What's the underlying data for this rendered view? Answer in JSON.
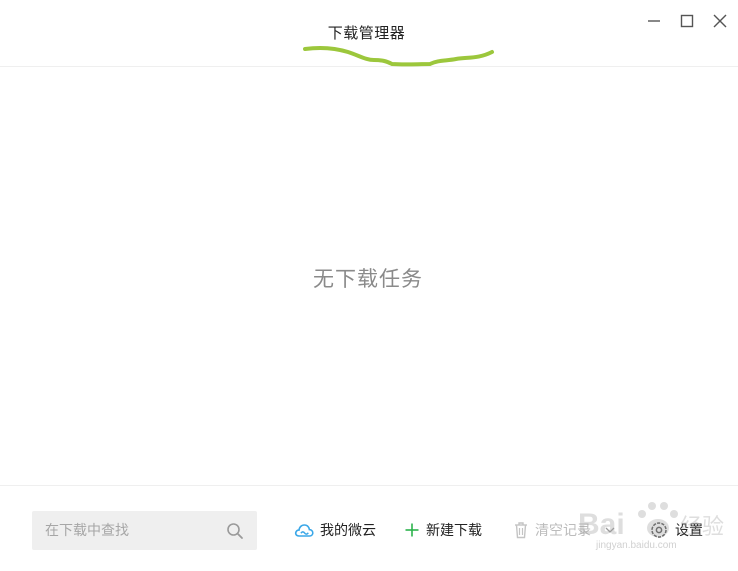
{
  "window": {
    "title": "下载管理器"
  },
  "main": {
    "empty_message": "无下载任务"
  },
  "toolbar": {
    "search_placeholder": "在下载中查找",
    "search_value": "",
    "my_cloud_label": "我的微云",
    "new_download_label": "新建下载",
    "clear_records_label": "清空记录",
    "settings_label": "设置"
  },
  "watermark": {
    "text": "jingyan.baidu.com"
  },
  "icons": {
    "minimize": "minimize-icon",
    "maximize": "maximize-icon",
    "close": "close-icon",
    "search": "search-icon",
    "cloud": "cloud-icon",
    "plus": "plus-icon",
    "trash": "trash-icon",
    "chevron": "chevron-down-icon",
    "gear": "gear-icon"
  },
  "colors": {
    "annotation_stroke": "#9cc73c",
    "cloud_blue": "#3aa7e8",
    "plus_green": "#2bb24c",
    "disabled_gray": "#bcbcbc",
    "empty_text": "#8a8a8a"
  }
}
